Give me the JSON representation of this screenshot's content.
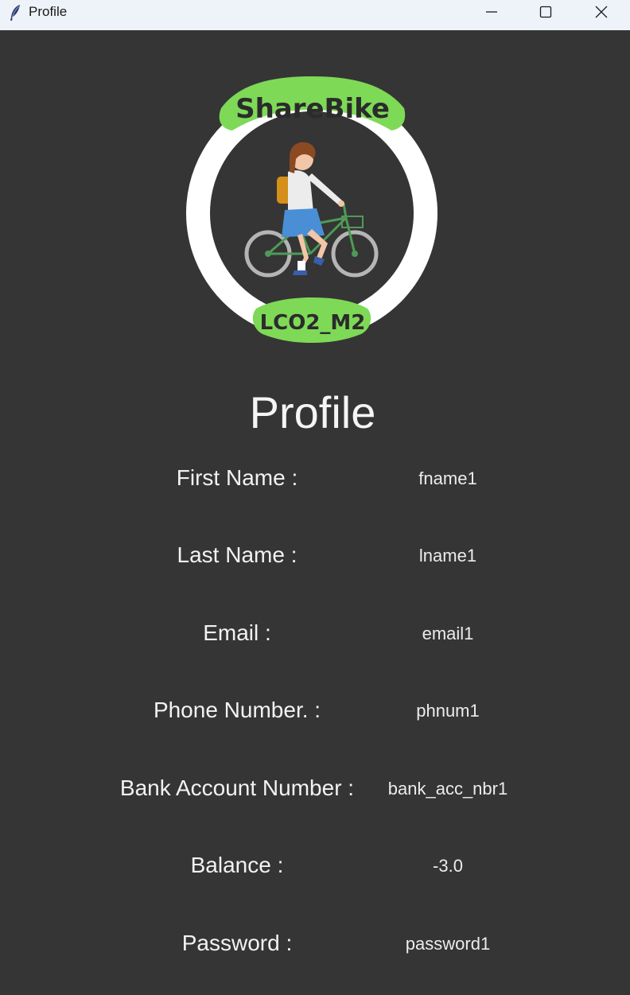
{
  "window": {
    "title": "Profile",
    "controls": [
      "minimize-icon",
      "maximize-icon",
      "close-icon"
    ]
  },
  "logo": {
    "top_text": "ShareBike",
    "bottom_text": "LCO2_M2",
    "accent_color": "#7ed957",
    "ring_color": "#ffffff"
  },
  "page": {
    "title": "Profile"
  },
  "fields": [
    {
      "label": "First Name :",
      "value": "fname1"
    },
    {
      "label": "Last Name :",
      "value": "lname1"
    },
    {
      "label": "Email :",
      "value": "email1"
    },
    {
      "label": "Phone Number. :",
      "value": "phnum1"
    },
    {
      "label": "Bank Account Number :",
      "value": "bank_acc_nbr1"
    },
    {
      "label": "Balance :",
      "value": "-3.0"
    },
    {
      "label": "Password :",
      "value": "password1"
    }
  ],
  "colors": {
    "background": "#353535",
    "titlebar": "#eef3f9",
    "text": "#f2f2f2"
  }
}
